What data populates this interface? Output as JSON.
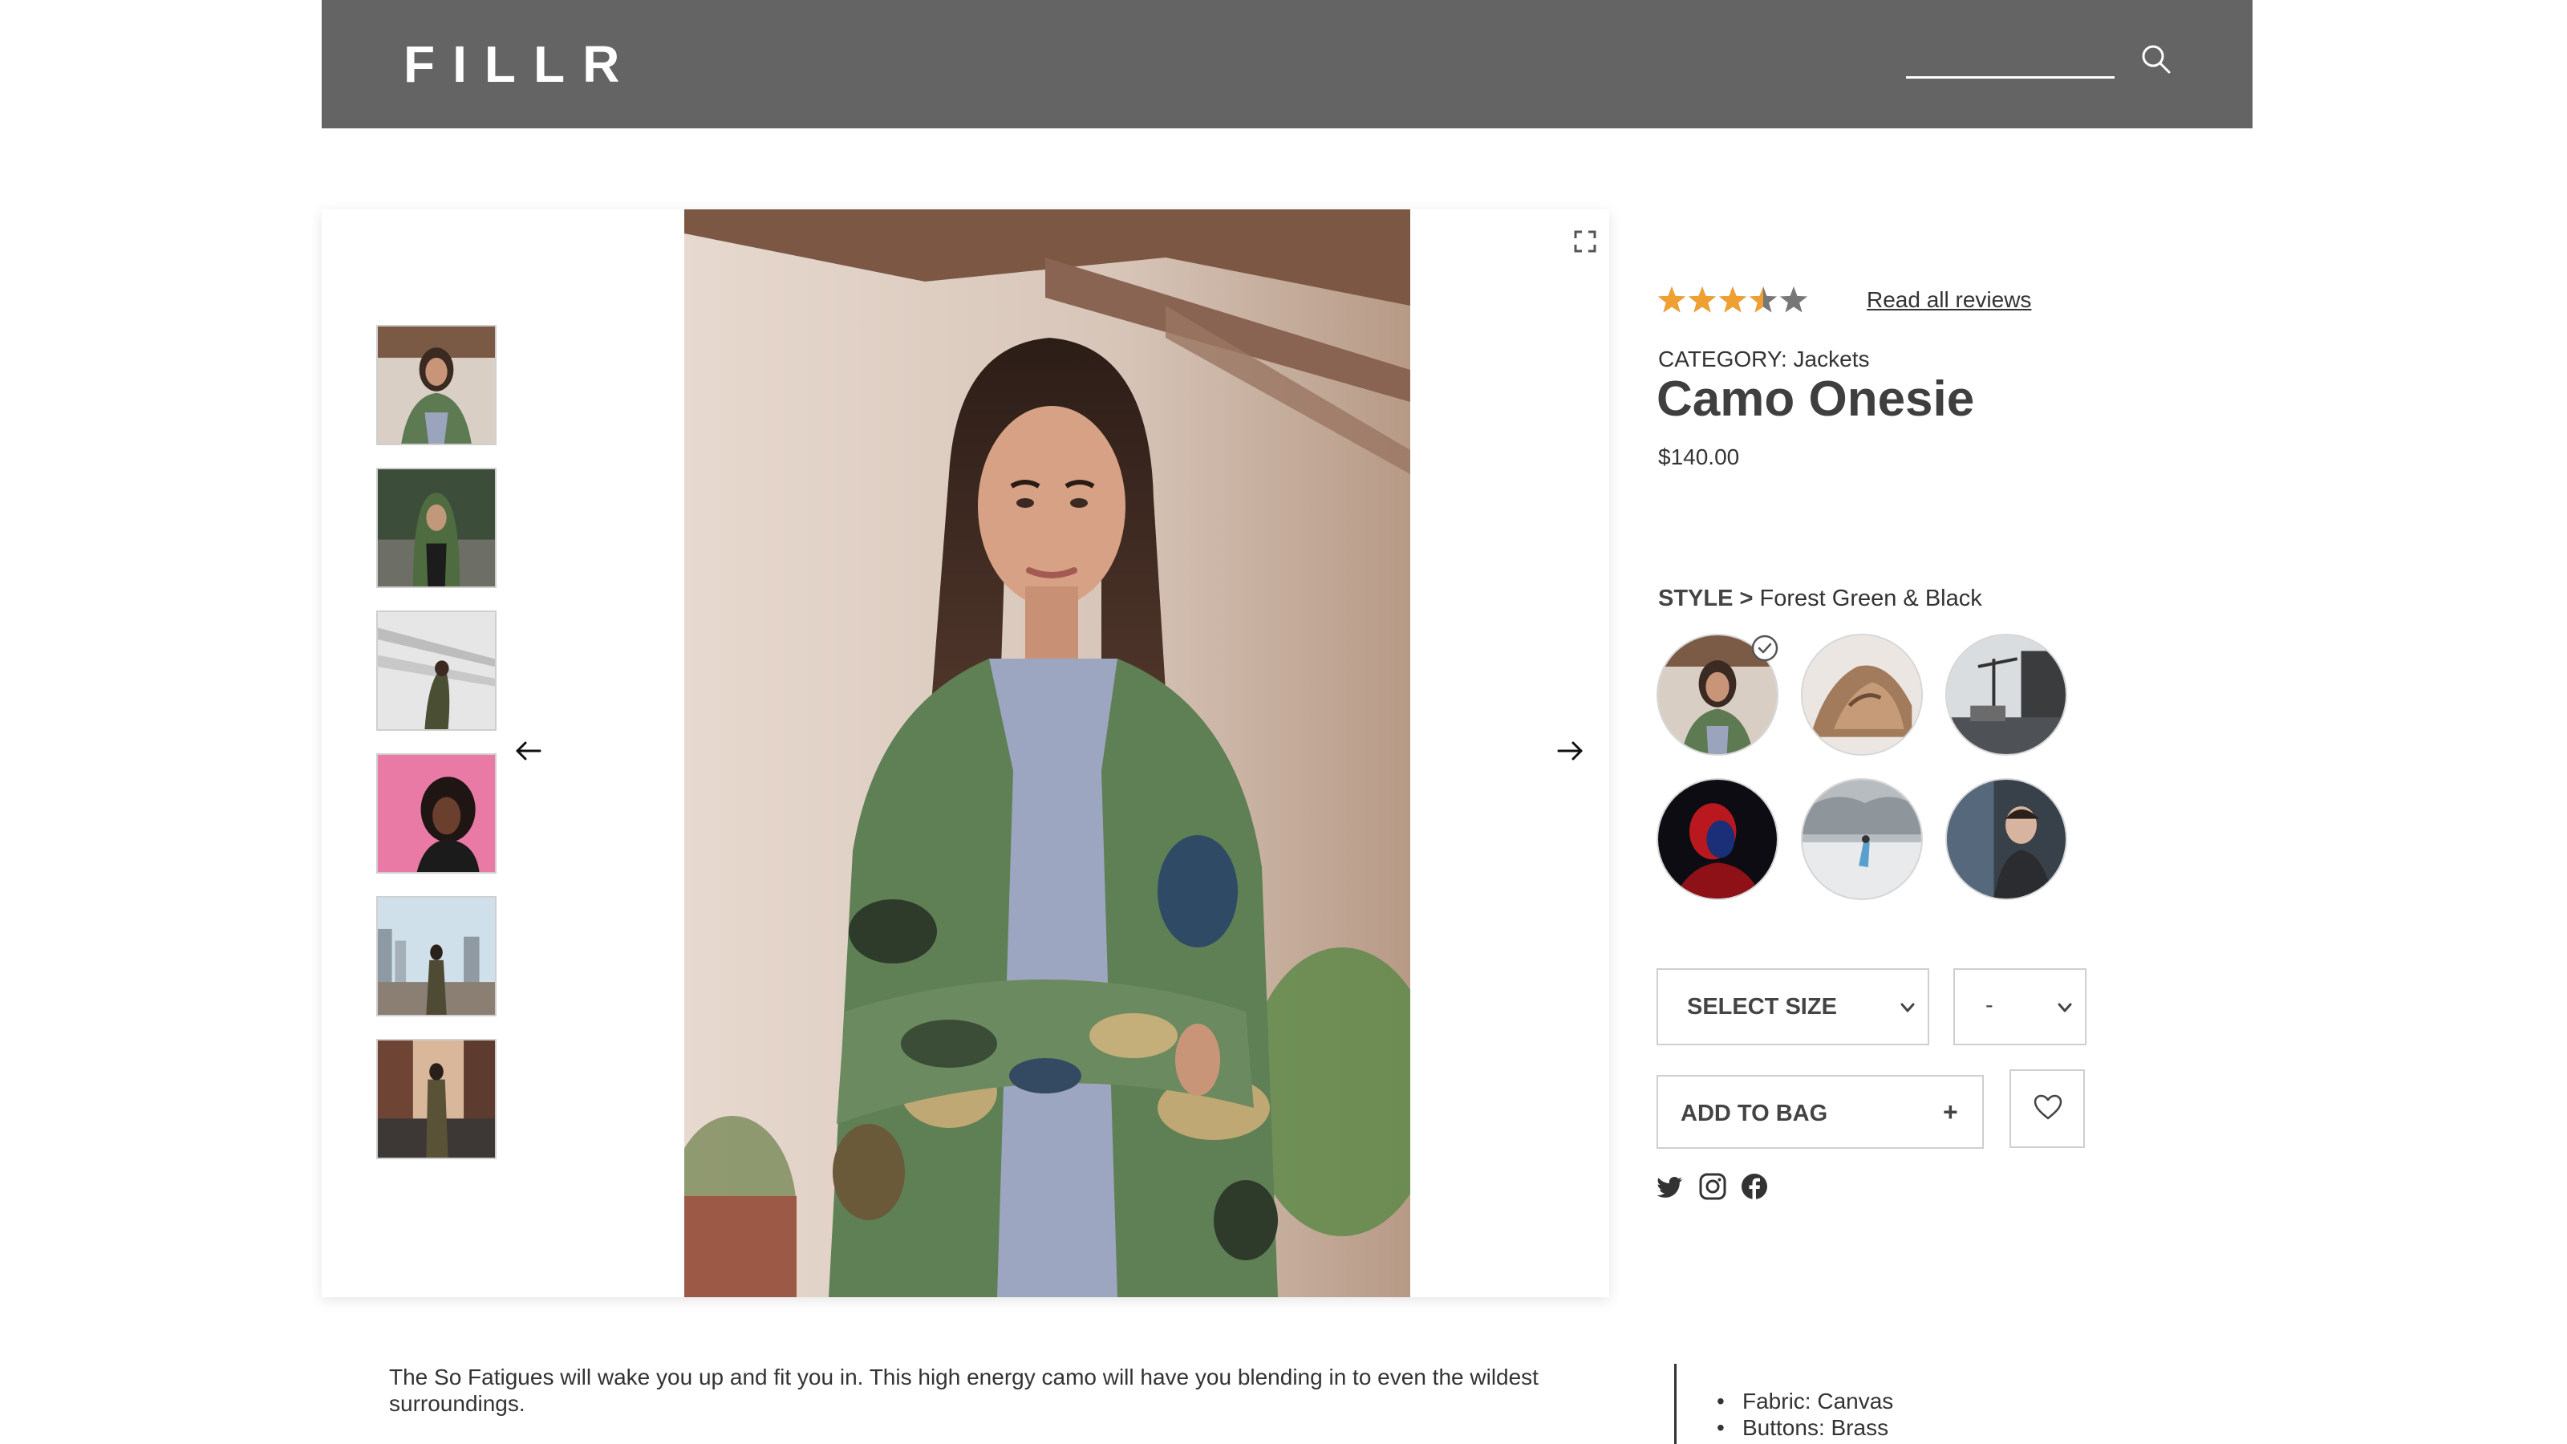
{
  "header": {
    "logo": "FILLR",
    "search": {
      "value": "",
      "placeholder": ""
    },
    "icons": {
      "search": "search-icon"
    },
    "background": "#646464"
  },
  "gallery": {
    "thumbnails": [
      {
        "name": "thumb-camo-woman"
      },
      {
        "name": "thumb-hooded-woman"
      },
      {
        "name": "thumb-architecture"
      },
      {
        "name": "thumb-pink-portrait"
      },
      {
        "name": "thumb-city-rails"
      },
      {
        "name": "thumb-brick-sunset"
      }
    ],
    "icons": {
      "prev": "arrow-left-icon",
      "next": "arrow-right-icon",
      "fullscreen": "expand-icon"
    }
  },
  "product": {
    "rating": 3.5,
    "rating_max": 5,
    "reviews_link": "Read all reviews",
    "category_label": "CATEGORY: Jackets",
    "title": "Camo Onesie",
    "price": "$140.00",
    "style_heading": "STYLE >",
    "style_value": "Forest Green & Black",
    "swatches": [
      {
        "name": "swatch-camo",
        "selected": true
      },
      {
        "name": "swatch-rock"
      },
      {
        "name": "swatch-harbor"
      },
      {
        "name": "swatch-red-neon"
      },
      {
        "name": "swatch-snow"
      },
      {
        "name": "swatch-street"
      }
    ],
    "size_select": "SELECT SIZE",
    "qty_select": "-",
    "add_to_bag": "ADD TO BAG",
    "add_icon": "+",
    "wishlist_icon": "heart-icon",
    "social": [
      "twitter-icon",
      "instagram-icon",
      "facebook-icon"
    ],
    "description": "The So Fatigues will wake you up and fit you in. This high energy camo will have you blending in to even the wildest surroundings.",
    "specs": [
      "Fabric: Canvas",
      "Buttons: Brass"
    ]
  },
  "colors": {
    "star": "#f0a030",
    "star_empty": "#777777",
    "text": "#333333"
  }
}
